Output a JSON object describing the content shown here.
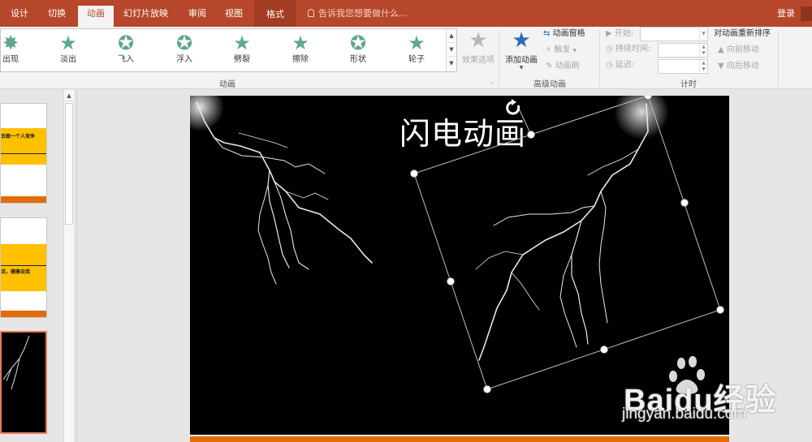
{
  "tabs": [
    {
      "label": "设计",
      "left": 0
    },
    {
      "label": "切换"
    },
    {
      "label": "动画",
      "active": true
    },
    {
      "label": "幻灯片放映"
    },
    {
      "label": "审阅"
    },
    {
      "label": "视图"
    },
    {
      "label": "格式",
      "contextual": true
    }
  ],
  "tell_me": "告诉我您想要做什么...",
  "login": "登录",
  "animations": [
    {
      "label": "出现"
    },
    {
      "label": "淡出"
    },
    {
      "label": "飞入"
    },
    {
      "label": "浮入"
    },
    {
      "label": "劈裂"
    },
    {
      "label": "擦除"
    },
    {
      "label": "形状"
    },
    {
      "label": "轮子"
    }
  ],
  "effect_options": "效果选项",
  "animation_group": "动画",
  "add_animation": "添加动画",
  "animation_pane": "动画窗格",
  "trigger": "触发",
  "animation_painter": "动画刷",
  "advanced_group": "高级动画",
  "start_label": "开始:",
  "duration_label": "持续时间:",
  "delay_label": "延迟:",
  "timing_group": "计时",
  "reorder_title": "对动画重新排序",
  "move_earlier": "向前移动",
  "move_later": "向后移动",
  "thumbs": [
    {
      "text": "去跟一个人竞争"
    },
    {
      "text": "活，健康自我"
    }
  ],
  "slide_title": "闪电动画",
  "watermark_text": "Baidu经验",
  "watermark_url": "jingyan.baidu.com"
}
